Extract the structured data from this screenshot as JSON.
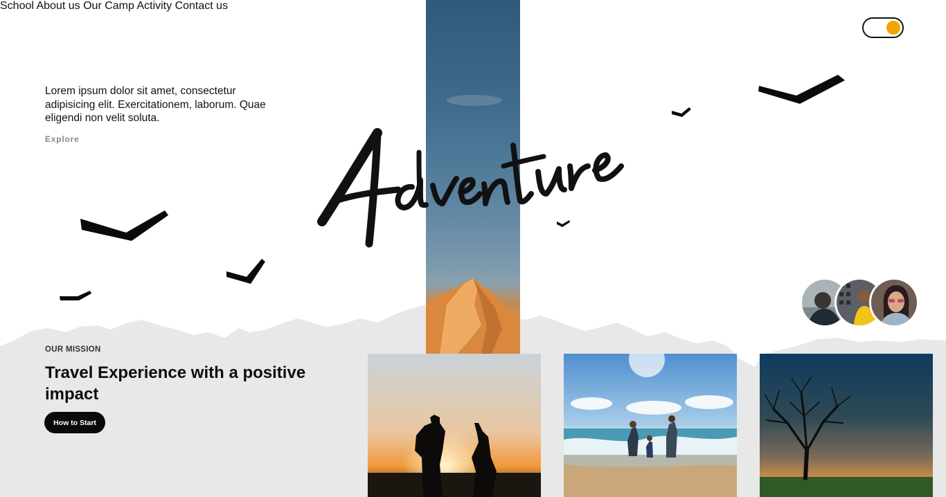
{
  "nav": {
    "left": [
      {
        "id": "school",
        "label": "School"
      },
      {
        "id": "about",
        "label": "About us"
      },
      {
        "id": "camp",
        "label": "Our Camp"
      }
    ],
    "right": [
      {
        "id": "activity",
        "label": "Activity"
      },
      {
        "id": "contact",
        "label": "Contact us"
      }
    ],
    "theme_toggle": {
      "state": "on",
      "knob_color": "#f5a300"
    }
  },
  "hero": {
    "intro": "Lorem ipsum dolor sit amet, consectetur adipisicing elit. Exercitationem, laborum. Quae eligendi non velit soluta.",
    "explore_label": "Explore",
    "brand_logo": "Adventure"
  },
  "mission": {
    "label": "OUR MISSION",
    "title": "Travel Experience with a positive impact",
    "cta_label": "How to Start"
  },
  "colors": {
    "accent": "#f5a300",
    "text": "#111111",
    "band": "#e8e8e8",
    "cta_bg": "#0a0a0a"
  },
  "icons": {
    "birds": "bird-silhouette-icon",
    "theme": "theme-toggle-icon"
  }
}
